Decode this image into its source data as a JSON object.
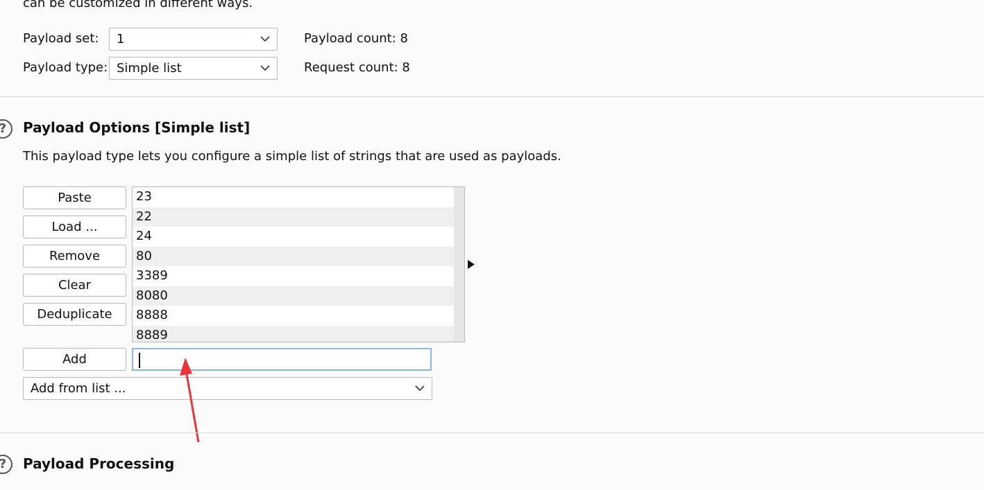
{
  "intro": {
    "text_fragment": "can be customized in different ways."
  },
  "payload_sets": {
    "set_label": "Payload set:",
    "set_value": "1",
    "type_label": "Payload type:",
    "type_value": "Simple list",
    "count_label": "Payload count:",
    "count_value": "8",
    "request_label": "Request count:",
    "request_value": "8"
  },
  "payload_options": {
    "title": "Payload Options [Simple list]",
    "description": "This payload type lets you configure a simple list of strings that are used as payloads.",
    "buttons": [
      "Paste",
      "Load ...",
      "Remove",
      "Clear",
      "Deduplicate"
    ],
    "items": [
      "23",
      "22",
      "24",
      "80",
      "3389",
      "8080",
      "8888",
      "8889"
    ],
    "add_label": "Add",
    "add_value": "",
    "add_from_list": "Add from list ..."
  },
  "payload_processing": {
    "title": "Payload Processing",
    "help_glyph": "?"
  },
  "colors": {
    "annotation_arrow": "#e8343a",
    "focus_border": "#8fb3e0"
  },
  "icons": [
    "help-icon",
    "chevron-down-icon",
    "expand-arrow-icon"
  ]
}
